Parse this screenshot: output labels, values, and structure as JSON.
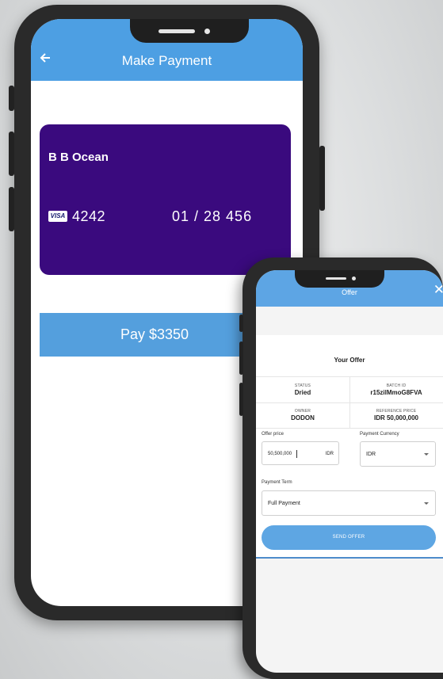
{
  "payment_screen": {
    "title": "Make Payment",
    "back_icon": "arrow-left-icon",
    "card": {
      "holder": "B B Ocean",
      "brand": "VISA",
      "last4": "4242",
      "expiry_cvv": "01 / 28 456",
      "color": "#3a0a7e"
    },
    "pay_button": "Pay $3350",
    "accent_color": "#4d9fe3"
  },
  "offer_screen": {
    "title": "Offer",
    "close_icon": "close-icon",
    "heading": "Your Offer",
    "info": {
      "status_label": "STATUS",
      "status_value": "Dried",
      "batch_label": "BATCH ID",
      "batch_value": "r15zilMmoG8FVA",
      "owner_label": "OWNER",
      "owner_value": "DODON",
      "ref_label": "REFERENCE PRICE",
      "ref_value": "IDR 50,000,000"
    },
    "offer_price_label": "Offer price",
    "offer_price_value": "50,500,000",
    "offer_price_unit": "IDR",
    "currency_label": "Payment Currency",
    "currency_value": "IDR",
    "term_label": "Payment Term",
    "term_value": "Full Payment",
    "send_button": "SEND OFFER"
  }
}
